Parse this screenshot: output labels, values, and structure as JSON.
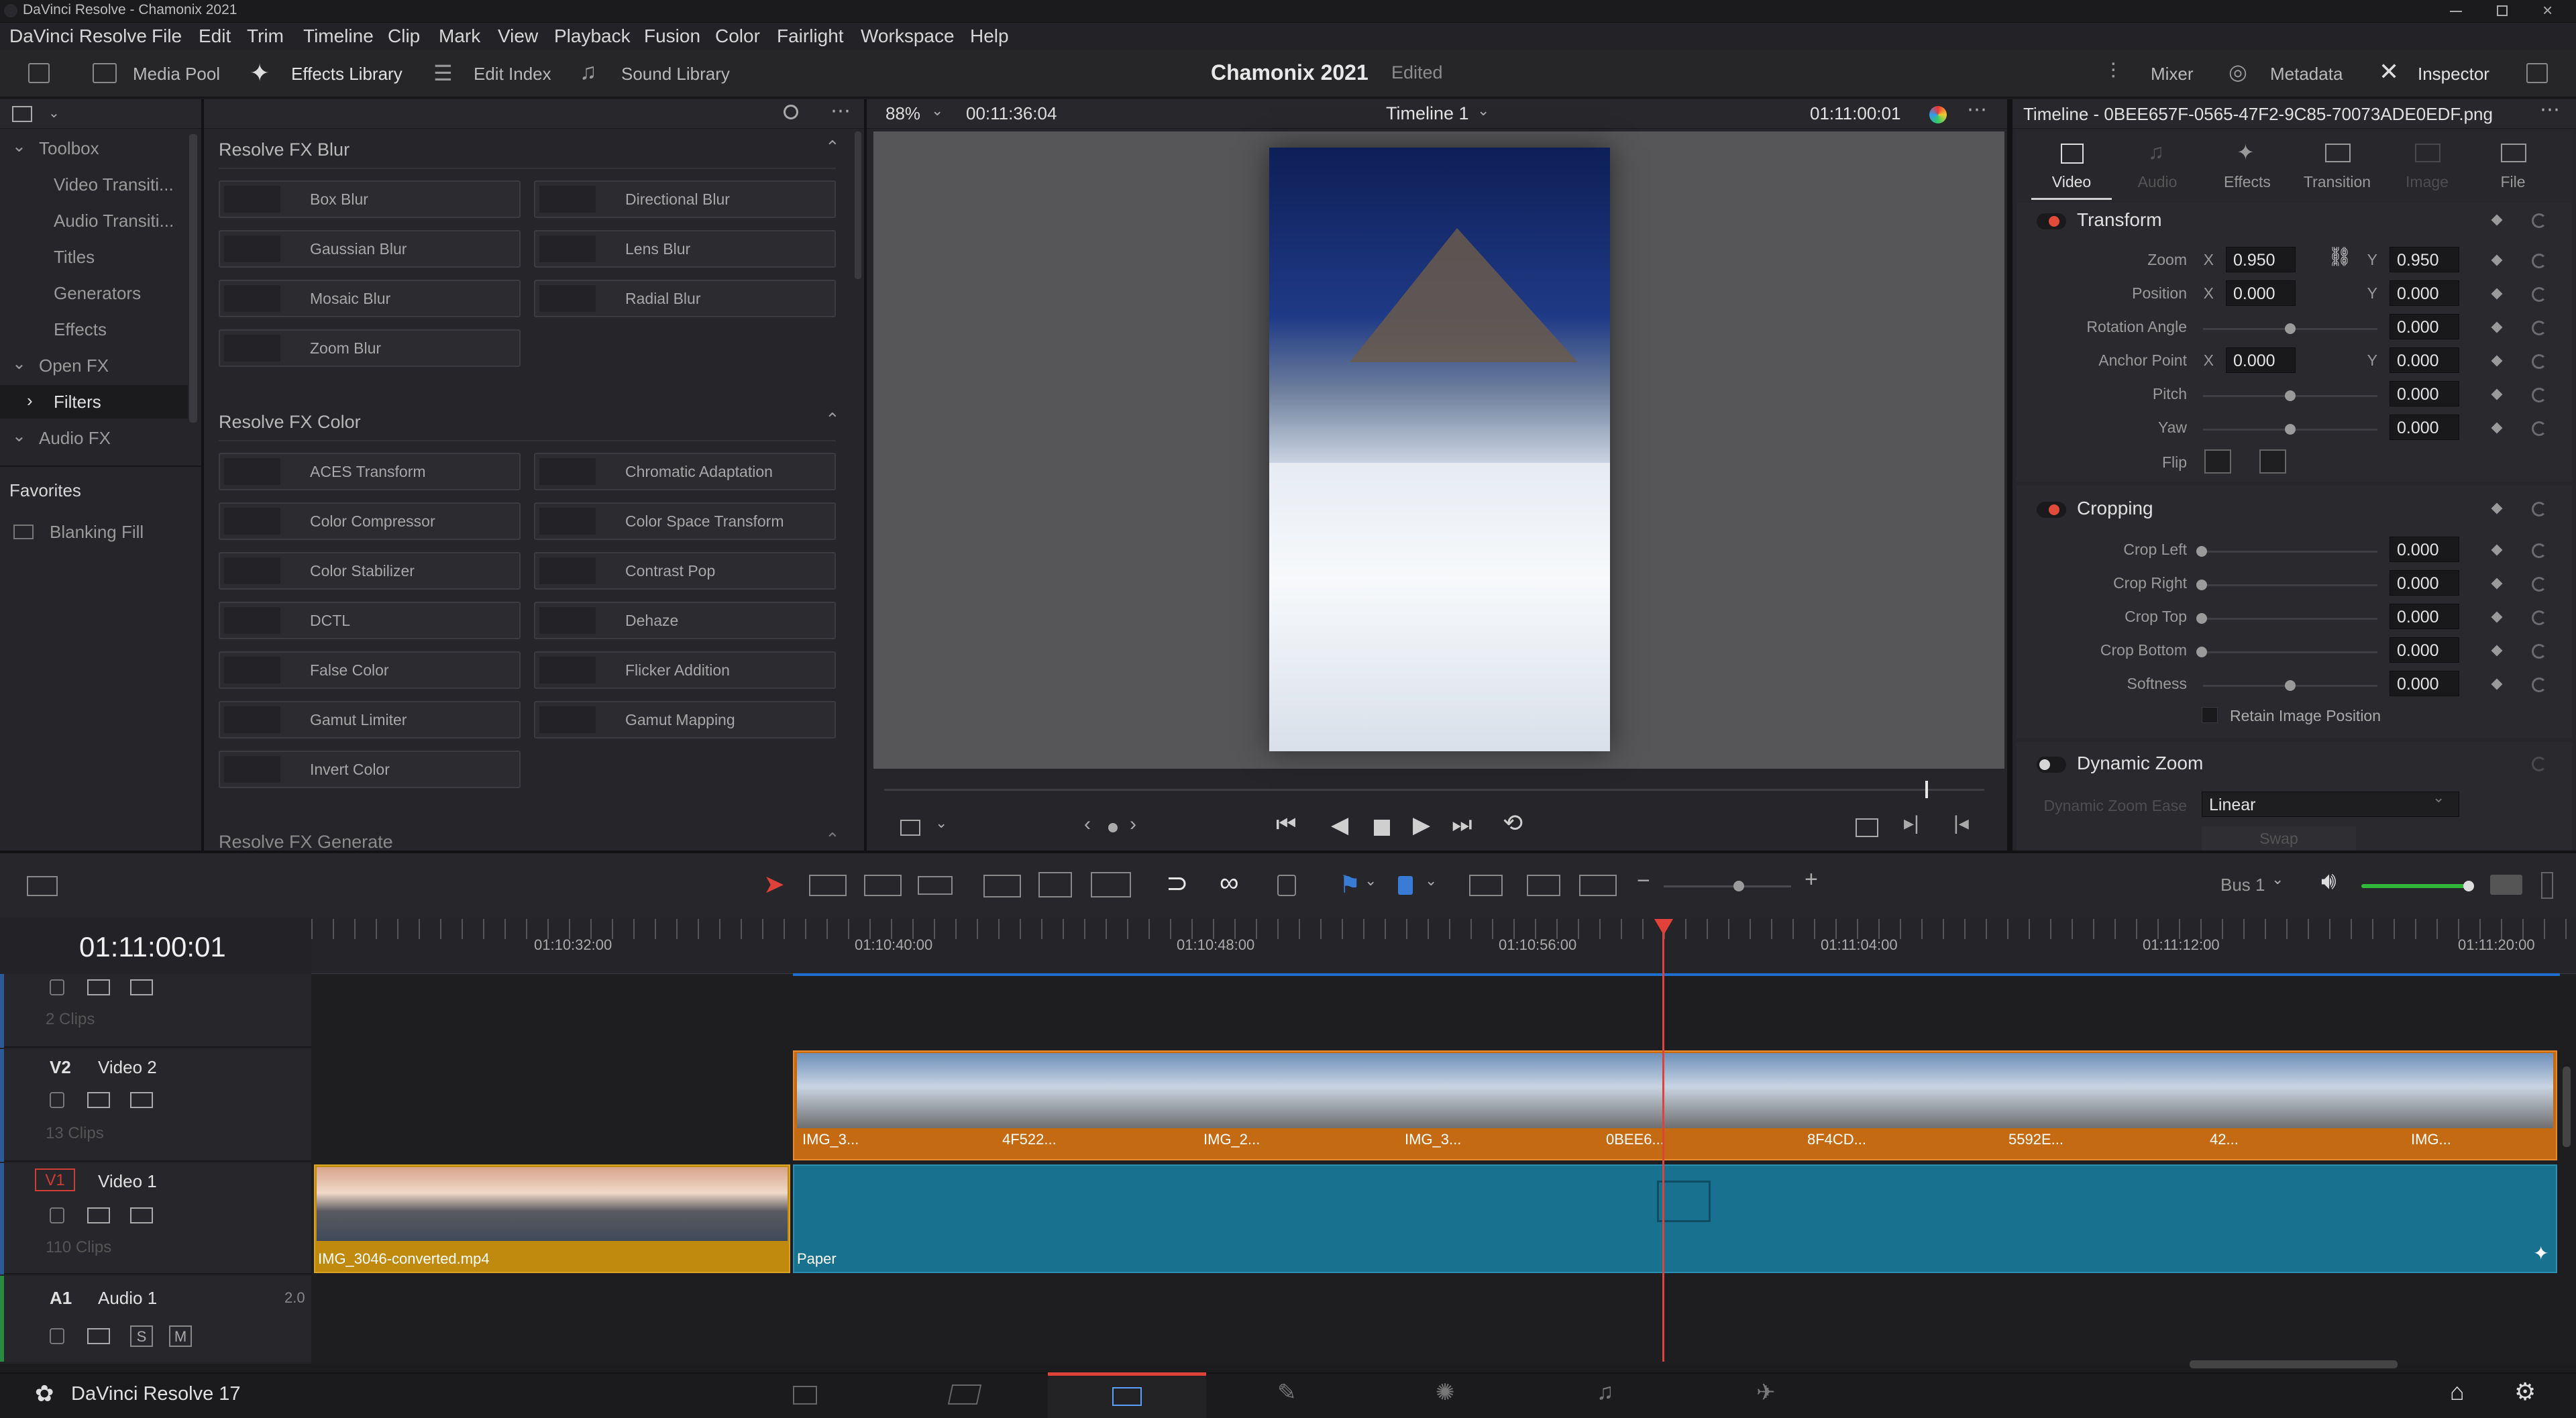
{
  "window": {
    "title": "DaVinci Resolve - Chamonix 2021"
  },
  "menu": [
    "DaVinci Resolve",
    "File",
    "Edit",
    "Trim",
    "Timeline",
    "Clip",
    "Mark",
    "View",
    "Playback",
    "Fusion",
    "Color",
    "Fairlight",
    "Workspace",
    "Help"
  ],
  "toolbar": {
    "media_pool": "Media Pool",
    "effects_library": "Effects Library",
    "edit_index": "Edit Index",
    "sound_library": "Sound Library",
    "project_name": "Chamonix 2021",
    "project_status": "Edited",
    "mixer": "Mixer",
    "metadata": "Metadata",
    "inspector": "Inspector"
  },
  "toolbox": {
    "items": [
      {
        "label": "Toolbox",
        "level": 0,
        "expanded": true
      },
      {
        "label": "Video Transiti...",
        "level": 1
      },
      {
        "label": "Audio Transiti...",
        "level": 1
      },
      {
        "label": "Titles",
        "level": 1
      },
      {
        "label": "Generators",
        "level": 1
      },
      {
        "label": "Effects",
        "level": 1
      },
      {
        "label": "Open FX",
        "level": 0,
        "expanded": true
      },
      {
        "label": "Filters",
        "level": 1,
        "selected": true
      },
      {
        "label": "Audio FX",
        "level": 0,
        "expanded": true
      }
    ],
    "favorites_title": "Favorites",
    "favorites": [
      "Blanking Fill"
    ]
  },
  "effects": {
    "sections": [
      {
        "title": "Resolve FX Blur",
        "items": [
          "Box Blur",
          "Directional Blur",
          "Gaussian Blur",
          "Lens Blur",
          "Mosaic Blur",
          "Radial Blur",
          "Zoom Blur"
        ]
      },
      {
        "title": "Resolve FX Color",
        "items": [
          "ACES Transform",
          "Chromatic Adaptation",
          "Color Compressor",
          "Color Space Transform",
          "Color Stabilizer",
          "Contrast Pop",
          "DCTL",
          "Dehaze",
          "False Color",
          "Flicker Addition",
          "Gamut Limiter",
          "Gamut Mapping",
          "Invert Color"
        ]
      },
      {
        "title": "Resolve FX Generate",
        "items": []
      }
    ]
  },
  "viewer": {
    "zoom": "88%",
    "source_timecode": "00:11:36:04",
    "timeline_name": "Timeline 1",
    "record_timecode": "01:11:00:01"
  },
  "inspector": {
    "header_title": "Timeline - 0BEE657F-0565-47F2-9C85-70073ADE0EDF.png",
    "tabs": [
      "Video",
      "Audio",
      "Effects",
      "Transition",
      "Image",
      "File"
    ],
    "active_tab": "Video",
    "transform": {
      "title": "Transform",
      "zoom_label": "Zoom",
      "zoom_x": "0.950",
      "zoom_y": "0.950",
      "position_label": "Position",
      "position_x": "0.000",
      "position_y": "0.000",
      "rotation_label": "Rotation Angle",
      "rotation": "0.000",
      "anchor_label": "Anchor Point",
      "anchor_x": "0.000",
      "anchor_y": "0.000",
      "pitch_label": "Pitch",
      "pitch": "0.000",
      "yaw_label": "Yaw",
      "yaw": "0.000",
      "flip_label": "Flip",
      "x_label": "X",
      "y_label": "Y"
    },
    "cropping": {
      "title": "Cropping",
      "crop_left_label": "Crop Left",
      "crop_left": "0.000",
      "crop_right_label": "Crop Right",
      "crop_right": "0.000",
      "crop_top_label": "Crop Top",
      "crop_top": "0.000",
      "crop_bottom_label": "Crop Bottom",
      "crop_bottom": "0.000",
      "softness_label": "Softness",
      "softness": "0.000",
      "retain_label": "Retain Image Position"
    },
    "dynamic_zoom": {
      "title": "Dynamic Zoom",
      "ease_label": "Dynamic Zoom Ease",
      "ease_value": "Linear",
      "swap_label": "Swap"
    }
  },
  "timeline": {
    "timecode": "01:11:00:01",
    "ruler": [
      "01:10:32:00",
      "01:10:40:00",
      "01:10:48:00",
      "01:10:56:00",
      "01:11:04:00",
      "01:11:12:00",
      "01:11:20:00"
    ],
    "bus": "Bus 1",
    "tracks": {
      "v3_clips": "2 Clips",
      "v2_id": "V2",
      "v2_name": "Video 2",
      "v2_clips": "13 Clips",
      "v1_id": "V1",
      "v1_name": "Video 1",
      "v1_clips": "110 Clips",
      "a1_id": "A1",
      "a1_name": "Audio 1",
      "a1_channels": "2.0"
    },
    "v2_clips": [
      "IMG_3...",
      "4F522...",
      "IMG_2...",
      "IMG_3...",
      "0BEE6...",
      "8F4CD...",
      "5592E...",
      "42...",
      "IMG..."
    ],
    "v1_clips": [
      "IMG_3046-converted.mp4",
      "Paper"
    ],
    "solo_label": "S",
    "mute_label": "M"
  },
  "footer": {
    "app": "DaVinci Resolve 17"
  }
}
